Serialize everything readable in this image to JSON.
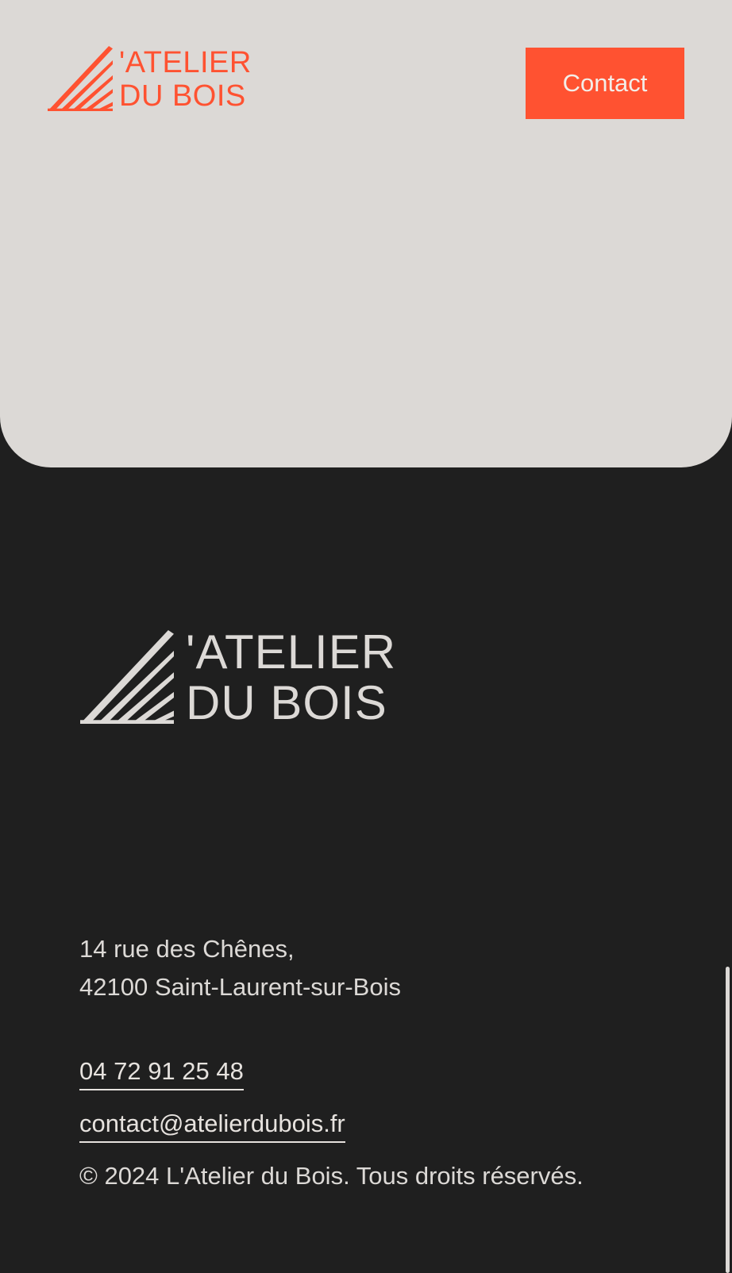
{
  "header": {
    "logo": {
      "line1": "'ATELIER",
      "line2": "DU BOIS",
      "icon": "fan-rays-logo-icon"
    },
    "contact_label": "Contact"
  },
  "footer": {
    "logo": {
      "line1": "'ATELIER",
      "line2": "DU BOIS",
      "icon": "fan-rays-logo-icon"
    },
    "address": {
      "line1": "14 rue des Chênes,",
      "line2": "42100 Saint-Laurent-sur-Bois"
    },
    "phone": "04 72 91 25 48",
    "email": "contact@atelierdubois.fr",
    "copyright": "© 2024 L'Atelier du Bois. Tous droits réservés."
  },
  "colors": {
    "accent": "#ff5231",
    "hero_background": "#dcd9d6",
    "footer_background": "#1f1f1f",
    "footer_text": "#dcd9d6"
  }
}
